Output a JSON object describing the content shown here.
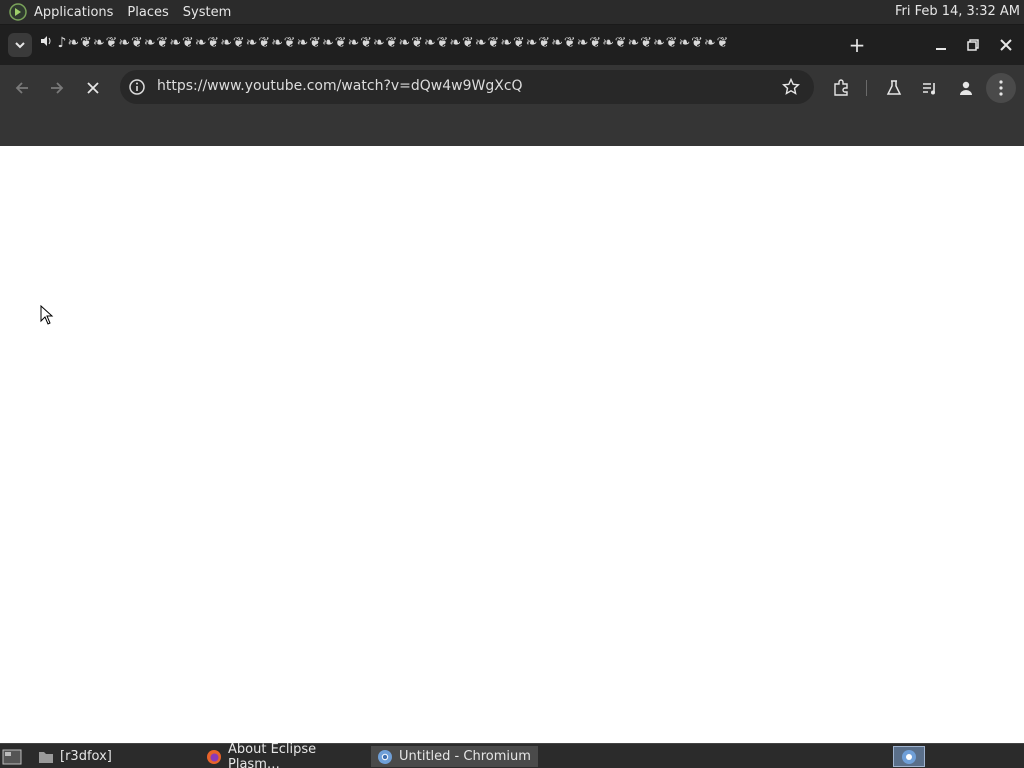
{
  "top_panel": {
    "menu": [
      "Applications",
      "Places",
      "System"
    ],
    "clock": "Fri Feb 14,  3:32 AM"
  },
  "tab": {
    "title": "♪❧❦❧❦❧❦❧❦❧❦❧❦❧❦❧❦❧❦❧❦❧❦❧❦❧❦❧❦❧❦❧❦❧❦❧❦❧❦❧❦❧❦❧❦❧❦❧❦❧❦❧❦",
    "new_tab_label": "+"
  },
  "omnibox": {
    "url": "https://www.youtube.com/watch?v=dQw4w9WgXcQ"
  },
  "taskbar": {
    "items": [
      {
        "label": "[r3dfox]",
        "icon": "folder-icon"
      },
      {
        "label": "About Eclipse Plasm…",
        "icon": "firefox-icon"
      },
      {
        "label": "Untitled - Chromium",
        "icon": "chromium-icon",
        "active": true
      }
    ]
  },
  "colors": {
    "panel": "#2b2b2b",
    "tabstrip": "#1f1f1f",
    "toolbar": "#353535",
    "omnibox": "#282828",
    "page": "#ffffff",
    "active_task": "#4a4a4a"
  }
}
